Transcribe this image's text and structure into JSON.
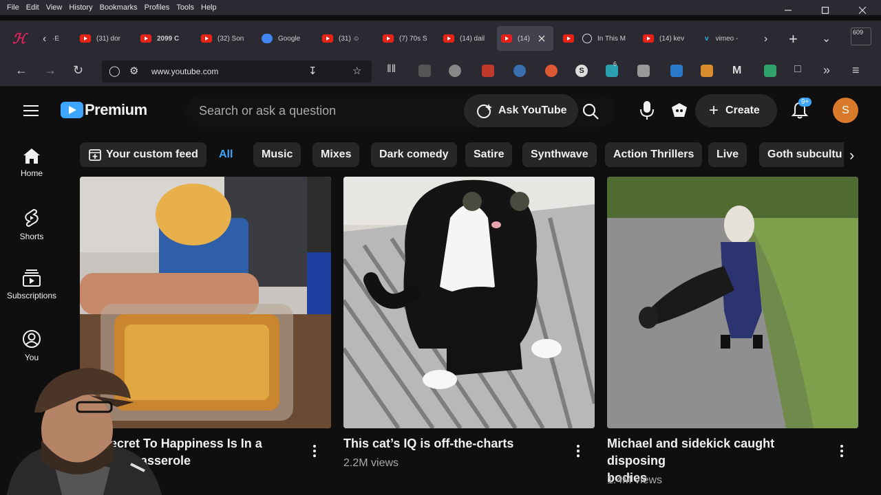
{
  "menu": [
    "File",
    "Edit",
    "View",
    "History",
    "Bookmarks",
    "Profiles",
    "Tools",
    "Help"
  ],
  "tabs": [
    {
      "label": "·E"
    },
    {
      "label": "(31) dor"
    },
    {
      "label": "2099 C"
    },
    {
      "label": "(32) Son"
    },
    {
      "label": "Google"
    },
    {
      "label": "(31) ☺"
    },
    {
      "label": "(7) 70s S"
    },
    {
      "label": "(14) dail"
    },
    {
      "label": "(14)"
    },
    {
      "label": ""
    },
    {
      "label": "In This M"
    },
    {
      "label": "(14) kev"
    },
    {
      "label": "vimeo -"
    }
  ],
  "tab_count": "609",
  "url": "www.youtube.com",
  "ext_badge": "6",
  "yt": {
    "logo_text": "Premium",
    "search_placeholder": "Search or ask a question",
    "ask_label": "Ask YouTube",
    "create_label": "Create",
    "notif_badge": "9+",
    "avatar_letter": "S"
  },
  "sidebar": [
    {
      "label": "Home"
    },
    {
      "label": "Shorts"
    },
    {
      "label": "Subscriptions"
    },
    {
      "label": "You"
    }
  ],
  "chips": [
    "Your custom feed",
    "All",
    "Music",
    "Mixes",
    "Dark comedy",
    "Satire",
    "Synthwave",
    "Action Thrillers",
    "Live",
    "Goth subcultu"
  ],
  "videos": [
    {
      "title_line1": "ecret To Happiness Is In a",
      "title_line2": "ma Casserole",
      "views": ""
    },
    {
      "title_line1": "This cat’s IQ is off-the-charts",
      "title_line2": "",
      "views": "2.2M views"
    },
    {
      "title_line1": "Michael and sidekick caught disposing",
      "title_line2": "bodies",
      "views": "1.4M views"
    }
  ],
  "colors": {
    "accent": "#3ea6ff",
    "bg": "#0f0f0f",
    "chrome": "#2b2a33",
    "avatar": "#d97a2b"
  }
}
